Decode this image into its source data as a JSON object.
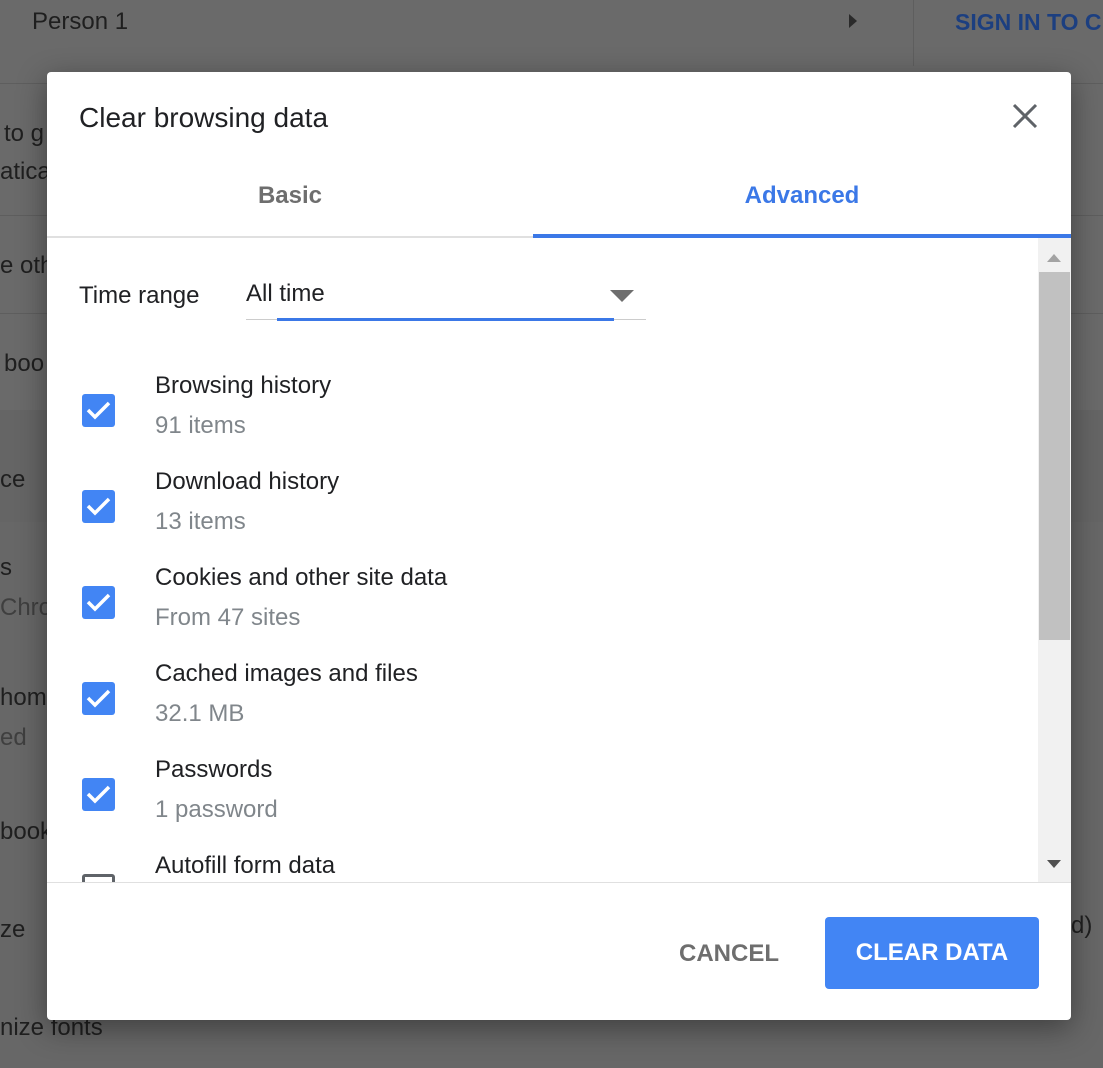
{
  "background": {
    "profile_name": "Person 1",
    "sign_in": "SIGN IN TO C",
    "fragments": [
      "to g",
      "atica",
      "e oth",
      "boo",
      "ce",
      "s",
      "Chro",
      "home",
      "ed",
      "book",
      "ze",
      "d)",
      "nize fonts"
    ]
  },
  "dialog": {
    "title": "Clear browsing data",
    "close_icon": "close-icon",
    "tabs": [
      {
        "label": "Basic",
        "active": false
      },
      {
        "label": "Advanced",
        "active": true
      }
    ],
    "time_range_label": "Time range",
    "time_range_value": "All time",
    "items": [
      {
        "label": "Browsing history",
        "sub": "91 items",
        "checked": true
      },
      {
        "label": "Download history",
        "sub": "13 items",
        "checked": true
      },
      {
        "label": "Cookies and other site data",
        "sub": "From 47 sites",
        "checked": true
      },
      {
        "label": "Cached images and files",
        "sub": "32.1 MB",
        "checked": true
      },
      {
        "label": "Passwords",
        "sub": "1 password",
        "checked": true
      },
      {
        "label": "Autofill form data",
        "sub": "",
        "checked": false
      }
    ],
    "cancel_label": "CANCEL",
    "clear_label": "CLEAR DATA",
    "accent": "#4285f4"
  }
}
